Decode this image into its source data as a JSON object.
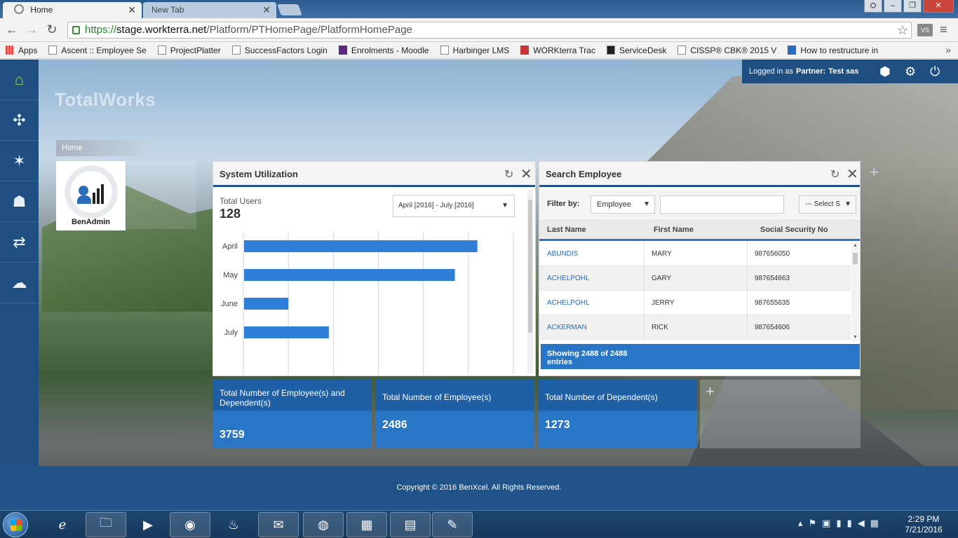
{
  "browser": {
    "tabs": [
      {
        "label": "Home",
        "active": true
      },
      {
        "label": "New Tab",
        "active": false
      }
    ],
    "url_scheme": "https://",
    "url_host": "stage.workterra.net",
    "url_path": "/Platform/PTHomePage/PlatformHomePage",
    "extension_label": "VS",
    "bookmarks": [
      "Apps",
      "Ascent :: Employee Se",
      "ProjectPlatter",
      "SuccessFactors Login",
      "Enrolments - Moodle",
      "Harbinger LMS",
      "WORKterra Trac",
      "ServiceDesk",
      "CISSP® CBK® 2015 V",
      "How to restructure in"
    ]
  },
  "app": {
    "brand": "TotalWorks",
    "breadcrumb": "Home",
    "user": {
      "prefix": "Logged in as",
      "role": "Partner:",
      "name": "Test sas"
    },
    "sidebar_icons": [
      "home-icon",
      "puzzle-icon",
      "user-star-icon",
      "user-icon",
      "transfer-arrows-icon",
      "chat-icon"
    ],
    "tiles": [
      {
        "label": "BenAdmin"
      }
    ],
    "footer": "Copyright © 2016 BenXcel. All Rights Reserved."
  },
  "system_utilization": {
    "title": "System Utilization",
    "total_users_label": "Total Users",
    "total_users_value": "128",
    "date_range": "April [2016] - July [2016]"
  },
  "chart_data": {
    "type": "bar",
    "orientation": "horizontal",
    "categories": [
      "April",
      "May",
      "June",
      "July"
    ],
    "values": [
      52,
      47,
      10,
      19
    ],
    "xlim": [
      0,
      60
    ],
    "grid": true,
    "color": "#2f7fd8"
  },
  "search_employee": {
    "title": "Search Employee",
    "filter_label": "Filter by:",
    "filter_value": "Employee",
    "filter_input_value": "",
    "secondary_select": "--- Select S",
    "columns": [
      "Last Name",
      "First Name",
      "Social Security No"
    ],
    "rows": [
      {
        "last": "ABUNDIS",
        "first": "MARY",
        "ssn": "987656050"
      },
      {
        "last": "ACHELPOHL",
        "first": "GARY",
        "ssn": "987654663"
      },
      {
        "last": "ACHELPOHL",
        "first": "JERRY",
        "ssn": "987655635"
      },
      {
        "last": "ACKERMAN",
        "first": "RICK",
        "ssn": "987654606"
      }
    ],
    "footer": "Showing 2488 of 2488 entries"
  },
  "stats": [
    {
      "label": "Total Number of Employee(s) and Dependent(s)",
      "value": "3759"
    },
    {
      "label": "Total Number of Employee(s)",
      "value": "2486"
    },
    {
      "label": "Total Number of Dependent(s)",
      "value": "1273"
    }
  ],
  "taskbar": {
    "time": "2:29 PM",
    "date": "7/21/2016",
    "apps": [
      "internet-explorer-icon",
      "file-explorer-icon",
      "media-player-icon",
      "chrome-icon",
      "flame-app-icon",
      "outlook-icon",
      "firefox-icon",
      "excel-icon",
      "notepad-icon",
      "paint-icon"
    ]
  }
}
